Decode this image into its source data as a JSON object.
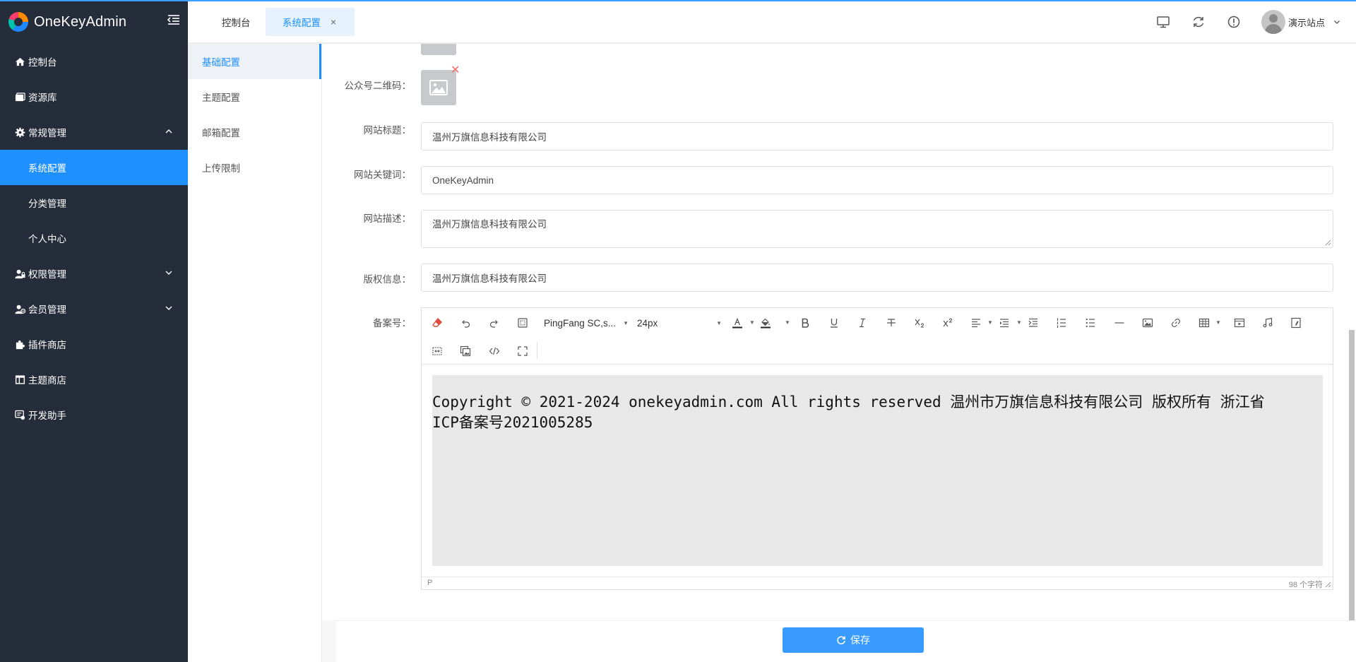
{
  "app": {
    "name": "OneKeyAdmin"
  },
  "sidebar": {
    "items": [
      {
        "label": "控制台",
        "icon": "home-icon"
      },
      {
        "label": "资源库",
        "icon": "folder-icon"
      },
      {
        "label": "常规管理",
        "icon": "gear-icon",
        "expanded": true
      },
      {
        "label": "系统配置",
        "sub": true,
        "active": true
      },
      {
        "label": "分类管理",
        "sub": true
      },
      {
        "label": "个人中心",
        "sub": true
      },
      {
        "label": "权限管理",
        "icon": "user-lock-icon",
        "expanded": false
      },
      {
        "label": "会员管理",
        "icon": "users-icon",
        "expanded": false
      },
      {
        "label": "插件商店",
        "icon": "puzzle-icon"
      },
      {
        "label": "主题商店",
        "icon": "layout-icon"
      },
      {
        "label": "开发助手",
        "icon": "dev-icon"
      }
    ]
  },
  "header": {
    "tabs": [
      {
        "label": "控制台"
      },
      {
        "label": "系统配置",
        "close": "×"
      }
    ],
    "user_name": "演示站点"
  },
  "config_menu": {
    "items": [
      "基础配置",
      "主题配置",
      "邮箱配置",
      "上传限制"
    ],
    "active_index": 0
  },
  "form": {
    "qrcode_label": "公众号二维码：",
    "site_title_label": "网站标题：",
    "site_title_value": "温州万旗信息科技有限公司",
    "keywords_label": "网站关键词：",
    "keywords_value": "OneKeyAdmin",
    "description_label": "网站描述：",
    "description_value": "温州万旗信息科技有限公司",
    "copyright_label": "版权信息：",
    "copyright_value": "温州万旗信息科技有限公司",
    "icp_label": "备案号："
  },
  "editor": {
    "font_family": "PingFang SC,s...",
    "font_size": "24px",
    "content_line1": "Copyright © 2021-2024 onekeyadmin.com All rights reserved 温州市万旗信息科技有限公司 版权所有  浙江省",
    "content_line2": "ICP备案号2021005285",
    "path": "P",
    "char_count": "98 个字符"
  },
  "actions": {
    "save_label": "保存"
  },
  "colors": {
    "primary": "#1e90ff",
    "sidebar_bg": "#252d3a",
    "delete": "#f56c6c"
  }
}
